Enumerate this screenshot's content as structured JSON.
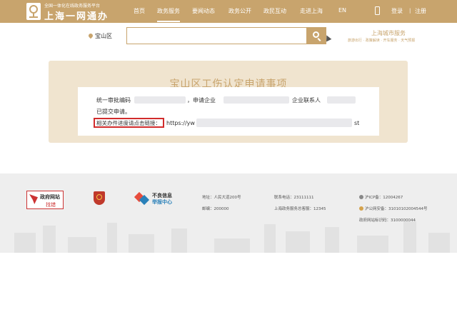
{
  "header": {
    "logo_sub": "全国一体化在线政务服务平台",
    "logo_main": "上海一网通办",
    "nav": [
      {
        "label": "首页"
      },
      {
        "label": "政务服务",
        "active": true
      },
      {
        "label": "要闻动态"
      },
      {
        "label": "政务公开"
      },
      {
        "label": "政民互动"
      },
      {
        "label": "走进上海"
      },
      {
        "label": "EN"
      }
    ],
    "login": "登录",
    "separator": "|",
    "register": "注册"
  },
  "search": {
    "location": "宝山区",
    "placeholder": "",
    "city_title": "上海城市服务",
    "city_links": "旅游出行 · 政策解读 · 开车服务 · 天气预报"
  },
  "card": {
    "title": "宝山区工伤认定申请事项",
    "line1_prefix": "统一审批编码",
    "line1_mid": "，申请企业",
    "line1_suffix": "企业联系人",
    "line2": "已提交申请。",
    "link_label": "相关办件进度请点击链接：",
    "link_url_start": "https://yw",
    "link_url_end": "st"
  },
  "footer": {
    "gov_badge_top": "政府网站",
    "gov_badge_bottom": "找错",
    "report_line1": "不良信息",
    "report_line2": "举报中心",
    "address": "地址：人民大道200号",
    "zipcode": "邮编：200000",
    "hotline": "联系电话：23111111",
    "service_hotline": "上海政务服务总客服：12345",
    "icp": "沪ICP备：12004267",
    "police": "沪公网安备：31010102004544号",
    "site_code": "政府网站标识码：3100000044"
  },
  "colors": {
    "brand": "#c8a46d",
    "card_bg": "#f0e4cf",
    "highlight_red": "#d12c2c",
    "footer_bg": "#eeeeee"
  }
}
